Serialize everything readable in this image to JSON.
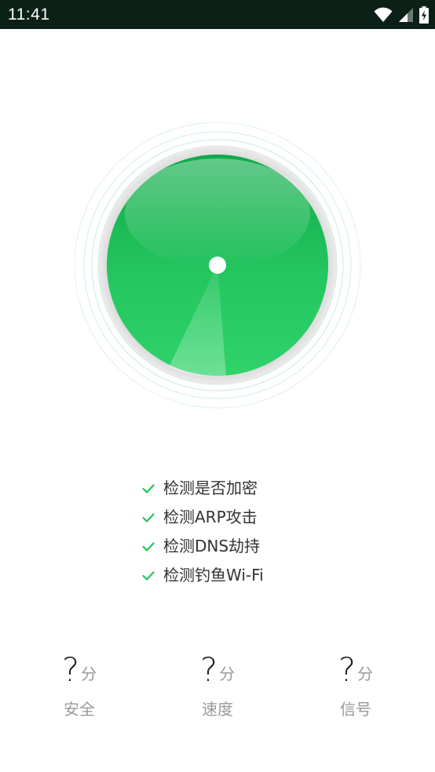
{
  "status_bar": {
    "time": "11:41",
    "icons": [
      "wifi-icon",
      "cellular-signal-icon",
      "battery-charging-icon"
    ]
  },
  "gauge": {
    "state": "idle",
    "color": "#22c35e"
  },
  "checks": [
    {
      "label": "检测是否加密",
      "icon": "check-icon"
    },
    {
      "label": "检测ARP攻击",
      "icon": "check-icon"
    },
    {
      "label": "检测DNS劫持",
      "icon": "check-icon"
    },
    {
      "label": "检测钓鱼Wi-Fi",
      "icon": "check-icon"
    }
  ],
  "scores": [
    {
      "value": "?",
      "unit": "分",
      "label": "安全"
    },
    {
      "value": "?",
      "unit": "分",
      "label": "速度"
    },
    {
      "value": "?",
      "unit": "分",
      "label": "信号"
    }
  ],
  "colors": {
    "accent": "#22c35e",
    "status_bar": "#0b2117",
    "muted_text": "#999999"
  }
}
